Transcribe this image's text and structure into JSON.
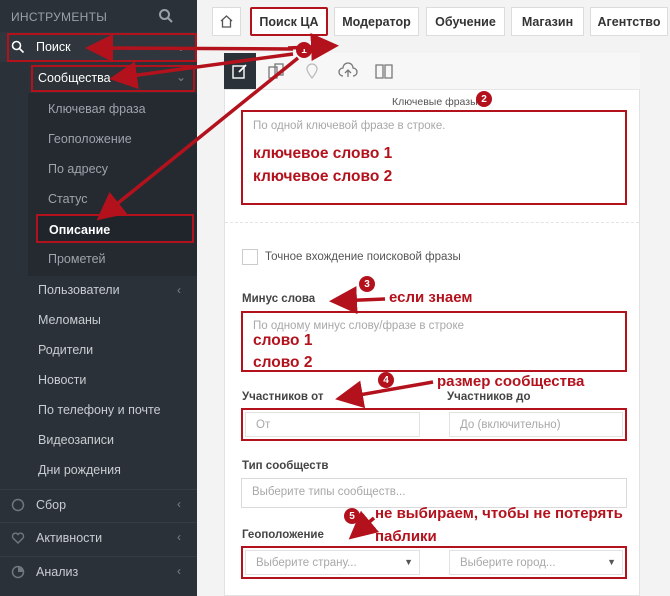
{
  "sidebar": {
    "title": "ИНСТРУМЕНТЫ",
    "search_icon": "search-icon",
    "items": [
      {
        "label": "Поиск"
      },
      {
        "label": "Сообщества"
      },
      {
        "label": "Ключевая фраза"
      },
      {
        "label": "Геоположение"
      },
      {
        "label": "По адресу"
      },
      {
        "label": "Статус"
      },
      {
        "label": "Описание"
      },
      {
        "label": "Прометей"
      },
      {
        "label": "Пользователи"
      },
      {
        "label": "Меломаны"
      },
      {
        "label": "Родители"
      },
      {
        "label": "Новости"
      },
      {
        "label": "По телефону и почте"
      },
      {
        "label": "Видеозаписи"
      },
      {
        "label": "Дни рождения"
      },
      {
        "label": "Сбор"
      },
      {
        "label": "Активности"
      },
      {
        "label": "Анализ"
      }
    ]
  },
  "tabs": [
    "Поиск ЦА",
    "Модератор",
    "Обучение",
    "Магазин",
    "Агентство"
  ],
  "form": {
    "keywords_label": "Ключевые фразы",
    "keywords_placeholder": "По одной ключевой фразе в строке.",
    "keywords_values": [
      "ключевое слово 1",
      "ключевое слово 2"
    ],
    "exact_label": "Точное вхождение поисковой фразы",
    "minus_label": "Минус слова",
    "minus_placeholder": "По одному минус слову/фразе в строке",
    "minus_values": [
      "слово 1",
      "слово 2"
    ],
    "members_from_label": "Участников от",
    "members_to_label": "Участников до",
    "members_from_placeholder": "От",
    "members_to_placeholder": "До (включительно)",
    "type_label": "Тип сообществ",
    "type_placeholder": "Выберите типы сообществ...",
    "geo_label": "Геоположение",
    "country_placeholder": "Выберите страну...",
    "city_placeholder": "Выберите город..."
  },
  "annotations": {
    "n1": "1",
    "n2": "2",
    "n3": "3",
    "n4": "4",
    "n5": "5",
    "if_known": "если знаем",
    "community_size": "размер сообщества",
    "dont_select_1": "не выбираем, чтобы не потерять",
    "dont_select_2": "паблики"
  },
  "colors": {
    "accent": "#b3121d",
    "sidebar": "#2b3138"
  }
}
